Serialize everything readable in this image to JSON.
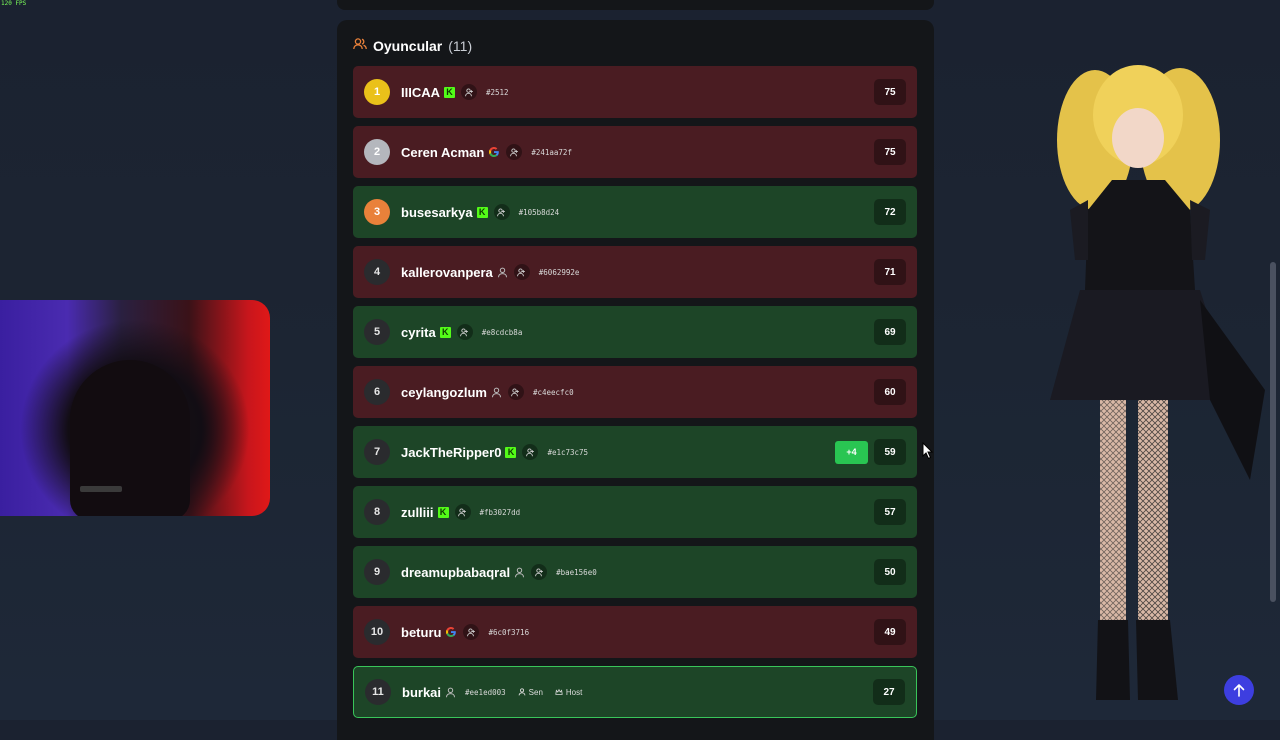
{
  "overlay": {
    "fps": "120 FPS"
  },
  "players_panel": {
    "title": "Oyuncular",
    "count": "(11)",
    "players": [
      {
        "rank": "1",
        "name": "IIICAA",
        "platform": "kick",
        "id": "#2512",
        "score": "75",
        "result": "red",
        "medal": "gold"
      },
      {
        "rank": "2",
        "name": "Ceren Acman",
        "platform": "google",
        "id": "#241aa72f",
        "score": "75",
        "result": "red",
        "medal": "silver"
      },
      {
        "rank": "3",
        "name": "busesarkya",
        "platform": "kick",
        "id": "#105b8d24",
        "score": "72",
        "result": "green",
        "medal": "bronze"
      },
      {
        "rank": "4",
        "name": "kallerovanpera",
        "platform": "guest",
        "id": "#6062992e",
        "score": "71",
        "result": "red"
      },
      {
        "rank": "5",
        "name": "cyrita",
        "platform": "kick",
        "id": "#e8cdcb8a",
        "score": "69",
        "result": "green"
      },
      {
        "rank": "6",
        "name": "ceylangozlum",
        "platform": "guest",
        "id": "#c4eecfc0",
        "score": "60",
        "result": "red"
      },
      {
        "rank": "7",
        "name": "JackTheRipper0",
        "platform": "kick",
        "id": "#e1c73c75",
        "score": "59",
        "result": "green",
        "delta": "+4"
      },
      {
        "rank": "8",
        "name": "zulliii",
        "platform": "kick",
        "id": "#fb3027dd",
        "score": "57",
        "result": "green"
      },
      {
        "rank": "9",
        "name": "dreamupbabaqral",
        "platform": "guest",
        "id": "#bae156e0",
        "score": "50",
        "result": "green"
      },
      {
        "rank": "10",
        "name": "beturu",
        "platform": "google",
        "id": "#6c0f3716",
        "score": "49",
        "result": "red"
      },
      {
        "rank": "11",
        "name": "burkai",
        "platform": "guest",
        "id": "#ee1ed003",
        "score": "27",
        "result": "green",
        "me": true,
        "you_label": "Sen",
        "host_label": "Host"
      }
    ]
  },
  "colors": {
    "row_red": "#4a1c22",
    "row_green": "#1d4527",
    "panel": "#141619",
    "accent_orange": "#e9813a",
    "kick_green": "#53fc18",
    "scroll_button": "#3d3ee0"
  }
}
